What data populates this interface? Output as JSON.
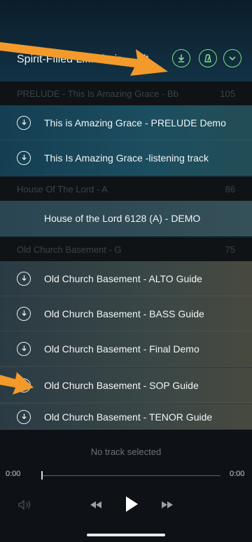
{
  "header": {
    "title": "Spirit-Filled Li...Choir – ...ft",
    "buttons": [
      "download-all",
      "metronome",
      "more"
    ]
  },
  "sections": [
    {
      "title": "PRELUDE - This Is Amazing Grace - Bb",
      "number": "105",
      "tracks": [
        "This is Amazing Grace - PRELUDE Demo",
        "This Is Amazing Grace -listening track"
      ]
    },
    {
      "title": "House Of The Lord - A",
      "number": "86",
      "tracks": [
        "House of the Lord 6128 (A) - DEMO"
      ]
    },
    {
      "title": "Old Church Basement - G",
      "number": "75",
      "tracks": [
        "Old Church Basement - ALTO Guide",
        "Old Church Basement - BASS Guide",
        "Old Church Basement - Final Demo",
        "Old Church Basement - SOP Guide",
        "Old Church Basement - TENOR Guide"
      ]
    }
  ],
  "player": {
    "status": "No track selected",
    "elapsed": "0:00",
    "total": "0:00",
    "progress": 0
  },
  "colors": {
    "accent": "#7fe08a",
    "arrow": "#f39a2a"
  }
}
